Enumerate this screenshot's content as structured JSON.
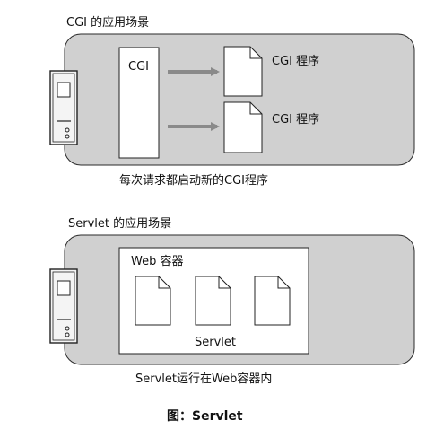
{
  "cgi_section": {
    "title": "CGI 的应用场景",
    "cgi_box_label": "CGI",
    "programs": [
      {
        "label": "CGI 程序"
      },
      {
        "label": "CGI 程序"
      }
    ],
    "caption": "每次请求都启动新的CGI程序"
  },
  "servlet_section": {
    "title": "Servlet 的应用场景",
    "container_label": "Web 容器",
    "servlet_label": "Servlet",
    "documents": 3,
    "caption": "Servlet运行在Web容器内"
  },
  "figure_caption": "图：Servlet",
  "colors": {
    "panel_fill": "#d0d0d0",
    "panel_stroke": "#2a2a2a",
    "box_fill": "#ffffff",
    "arrow": "#8a8a8a",
    "server_fill": "#f4f4f4"
  },
  "icons": [
    "server-icon",
    "document-icon",
    "arrow-right-icon"
  ]
}
